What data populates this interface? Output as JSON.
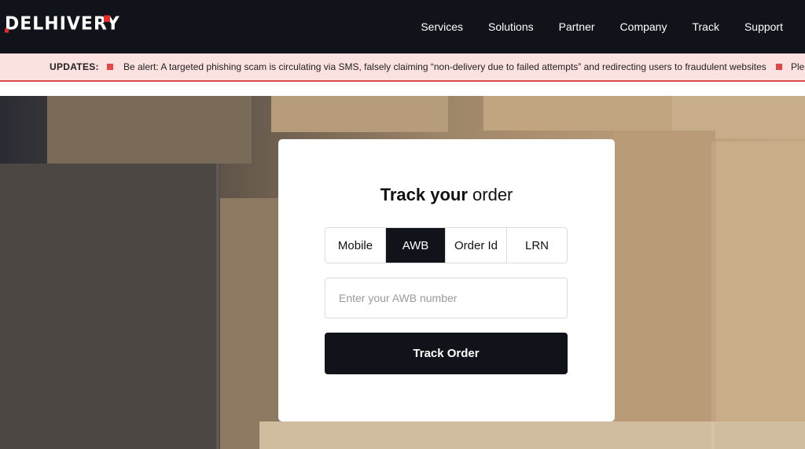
{
  "header": {
    "logo_text": "DELHIVERY",
    "nav": [
      "Services",
      "Solutions",
      "Partner",
      "Company",
      "Track",
      "Support"
    ]
  },
  "updates": {
    "label": "UPDATES:",
    "message": "Be alert: A targeted phishing scam is circulating via SMS, falsely claiming “non-delivery due to failed attempts” and redirecting users to fraudulent websites",
    "message_next": "Ple",
    "accent_color": "#e04848"
  },
  "track_card": {
    "title_bold": "Track your",
    "title_rest": "order",
    "tabs": [
      "Mobile",
      "AWB",
      "Order Id",
      "LRN"
    ],
    "active_tab": "AWB",
    "input_placeholder": "Enter your AWB number",
    "input_value": "",
    "button_label": "Track Order"
  },
  "colors": {
    "header_bg": "#11131a",
    "updates_bg": "#fbe1e0",
    "brand_red": "#e32d2d"
  }
}
